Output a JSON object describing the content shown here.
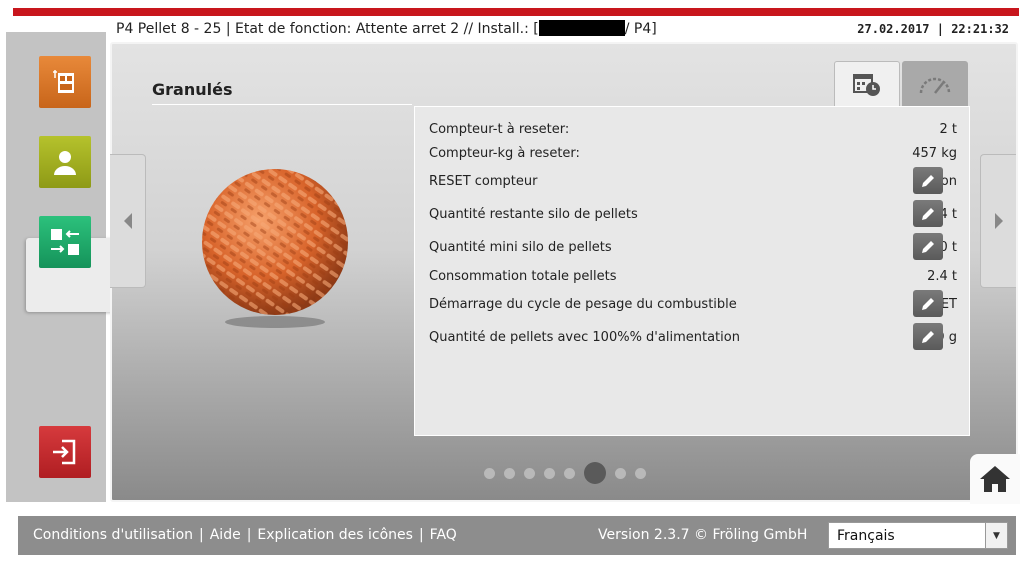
{
  "header": {
    "title_prefix": "P4 Pellet 8 - 25 | Etat de fonction: Attente arret 2 // Install.: [",
    "title_suffix": "/ P4]",
    "datetime": "27.02.2017 | 22:21:32"
  },
  "sidebar": {
    "items": [
      {
        "name": "boiler-icon",
        "color": "#d9731f"
      },
      {
        "name": "user-icon",
        "color": "#9fad1d"
      },
      {
        "name": "io-icon",
        "color": "#1fae6a"
      },
      {
        "name": "exit-icon",
        "color": "#c8262a"
      }
    ]
  },
  "main": {
    "title": "Granulés",
    "tabs": [
      {
        "name": "calendar-clock-icon",
        "active": true
      },
      {
        "name": "gauge-icon",
        "active": false
      }
    ],
    "rows": [
      {
        "label": "Compteur-t à reseter:",
        "value": "2 t",
        "editable": false
      },
      {
        "label": "Compteur-kg à reseter:",
        "value": "457 kg",
        "editable": false
      },
      {
        "label": "RESET compteur",
        "value": "Non",
        "editable": true
      },
      {
        "label": "Quantité restante silo de pellets",
        "value": "3.4 t",
        "editable": true
      },
      {
        "label": "Quantité mini silo de pellets",
        "value": "0.0 t",
        "editable": true
      },
      {
        "label": "Consommation totale pellets",
        "value": "2.4 t",
        "editable": false
      },
      {
        "label": "Démarrage du cycle de pesage du combustible",
        "value": "ARRET",
        "editable": true
      },
      {
        "label": "Quantité de pellets avec 100%% d'alimentation",
        "value": "529 g",
        "editable": true
      }
    ],
    "page_indicator": {
      "total": 8,
      "current": 6
    }
  },
  "footer": {
    "links": [
      "Conditions d'utilisation",
      "Aide",
      "Explication des icônes",
      "FAQ"
    ],
    "version": "Version 2.3.7 © Fröling GmbH",
    "language": "Français"
  },
  "colors": {
    "accent": "#c8161d"
  }
}
